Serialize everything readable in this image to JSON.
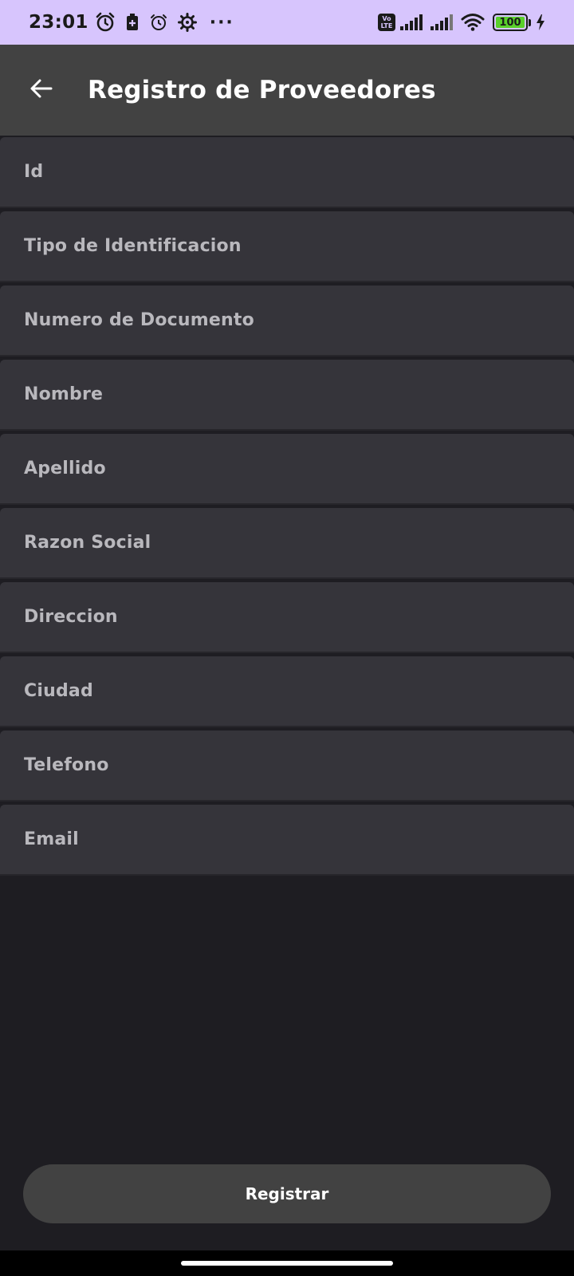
{
  "status_bar": {
    "time": "23:01",
    "left_icons": [
      "alarm-clock-icon",
      "battery-saver-icon",
      "alarm-icon",
      "settings-gear-icon",
      "more-dots-icon"
    ],
    "more": "···",
    "volte_top": "Vo",
    "volte_bottom": "LTE",
    "battery_level": "100",
    "background": "#d7c5fd",
    "battery_color": "#5ad02b"
  },
  "app_bar": {
    "title": "Registro de Proveedores",
    "back_icon": "arrow-back-icon",
    "background": "#424242"
  },
  "form": {
    "fields": [
      {
        "label": "Id"
      },
      {
        "label": "Tipo de Identificacion"
      },
      {
        "label": "Numero de Documento"
      },
      {
        "label": "Nombre"
      },
      {
        "label": "Apellido"
      },
      {
        "label": "Razon Social"
      },
      {
        "label": "Direccion"
      },
      {
        "label": "Ciudad"
      },
      {
        "label": "Telefono"
      },
      {
        "label": "Email"
      }
    ]
  },
  "actions": {
    "register_label": "Registrar"
  }
}
